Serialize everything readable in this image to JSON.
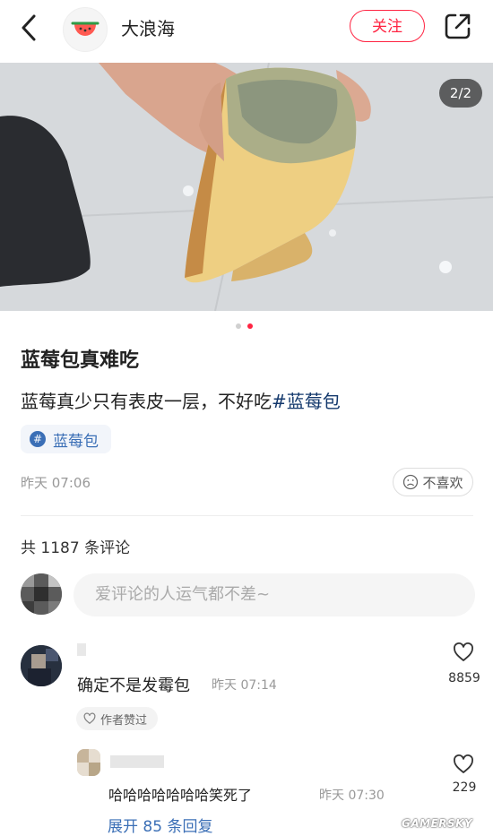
{
  "header": {
    "username": "大浪海",
    "follow_label": "关注",
    "colors": {
      "accent": "#ff2442"
    },
    "icons": {
      "back": "chevron-left-icon",
      "share": "share-icon",
      "avatar": "watermelon-icon"
    }
  },
  "photo": {
    "page_indicator": "2/2",
    "current_slide": 2,
    "total_slides": 2
  },
  "post": {
    "title": "蓝莓包真难吃",
    "body": "蓝莓真少只有表皮一层，不好吃",
    "body_hashtag": "#蓝莓包",
    "tag_label": "蓝莓包",
    "date": "昨天 07:06",
    "dislike_label": "不喜欢"
  },
  "comments": {
    "count_label": "共 1187 条评论",
    "input_placeholder": "爱评论的人运气都不差~",
    "items": [
      {
        "text": "确定不是发霉包",
        "time": "昨天 07:14",
        "likes": "8859",
        "author_liked_label": "作者赞过",
        "reply": {
          "text": "哈哈哈哈哈哈哈笑死了",
          "time": "昨天 07:30",
          "likes": "229"
        },
        "expand_label": "展开 85 条回复"
      }
    ]
  },
  "watermark": "GAMERSKY"
}
